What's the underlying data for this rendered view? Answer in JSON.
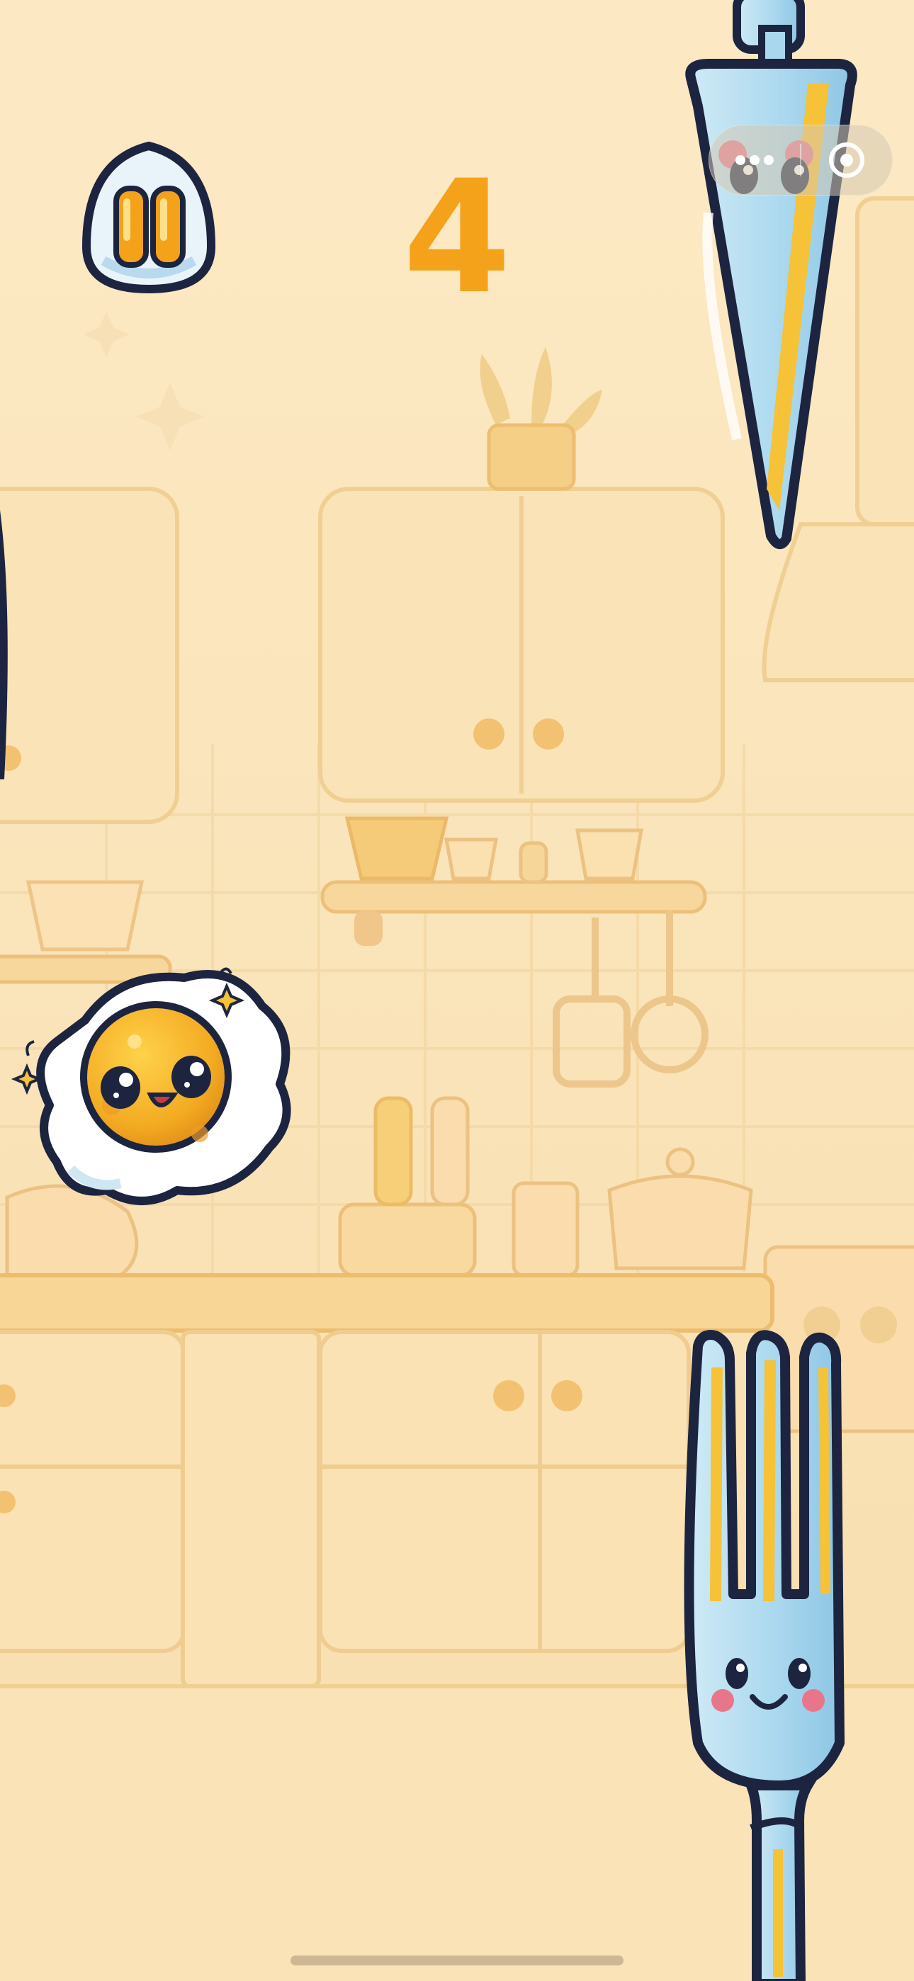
{
  "hud": {
    "score": "4",
    "pause_icon": "pause-icon",
    "menu_icon": "more-dots-icon",
    "close_icon": "target-circle-icon"
  },
  "game": {
    "player": "fried-egg-character",
    "obstacles": [
      "knife",
      "fork"
    ],
    "background": "kitchen"
  },
  "colors": {
    "background": "#fbe6bf",
    "score": "#f5a21b",
    "yolk": "#f6b326",
    "outline": "#1c2440"
  }
}
